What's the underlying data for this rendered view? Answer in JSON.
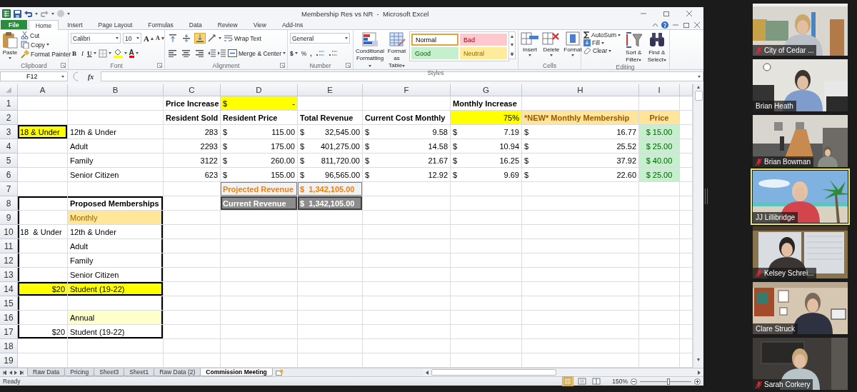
{
  "title_bar": {
    "title": "Membership Res vs NR  -  Microsoft Excel"
  },
  "ribbon_tabs": [
    {
      "label": "File",
      "kind": "file",
      "selected": false
    },
    {
      "label": "Home",
      "kind": "tab",
      "selected": true
    },
    {
      "label": "Insert",
      "kind": "tab",
      "selected": false
    },
    {
      "label": "Page Layout",
      "kind": "tab",
      "selected": false
    },
    {
      "label": "Formulas",
      "kind": "tab",
      "selected": false
    },
    {
      "label": "Data",
      "kind": "tab",
      "selected": false
    },
    {
      "label": "Review",
      "kind": "tab",
      "selected": false
    },
    {
      "label": "View",
      "kind": "tab",
      "selected": false
    },
    {
      "label": "Add-Ins",
      "kind": "tab",
      "selected": false
    }
  ],
  "ribbon_groups": [
    {
      "kind": "clipboard",
      "label": "Clipboard",
      "buttons": [
        "Paste",
        "Cut",
        "Copy",
        "Format Painter"
      ]
    },
    {
      "kind": "font",
      "label": "Font",
      "font_name": "Calibri",
      "font_size": "10",
      "buttons": [
        "A",
        "A",
        "B",
        "I",
        "U",
        "A"
      ]
    },
    {
      "kind": "alignment",
      "label": "Alignment",
      "vertical_align": [
        {
          "selected": false
        },
        {
          "selected": false
        },
        {
          "selected": true
        }
      ],
      "buttons": [
        "Wrap Text",
        "Merge & Center"
      ]
    },
    {
      "kind": "number",
      "label": "Number",
      "format": "General",
      "buttons": [
        "$",
        "%",
        ","
      ]
    },
    {
      "kind": "styles",
      "label": "Styles",
      "buttons": [
        "Conditional Formatting",
        "Format as Table"
      ],
      "cell_styles": [
        {
          "label": "Normal",
          "kind": "normal",
          "selected": true
        },
        {
          "label": "Bad",
          "kind": "bad",
          "selected": false
        },
        {
          "label": "Good",
          "kind": "good",
          "selected": false
        },
        {
          "label": "Neutral",
          "kind": "neutral",
          "selected": false
        }
      ]
    },
    {
      "kind": "cells",
      "label": "Cells",
      "buttons": [
        "Insert",
        "Delete",
        "Format"
      ]
    },
    {
      "kind": "editing",
      "label": "Editing",
      "buttons": [
        "AutoSum",
        "Fill",
        "Clear",
        "Sort & Filter",
        "Find & Select"
      ]
    }
  ],
  "formula_bar": {
    "name_box": "F12",
    "function_label": "fx"
  },
  "sheet": {
    "columns": [
      "A",
      "B",
      "C",
      "D",
      "E",
      "F",
      "G",
      "H",
      "I"
    ],
    "rows": [
      {
        "number": "1",
        "cells": [
          null,
          null,
          {
            "kind": "bold",
            "text": "Price Increase"
          },
          {
            "kind": "currency-highlight",
            "symbol": "$",
            "text": "-"
          },
          null,
          null,
          {
            "kind": "bold",
            "text": "Monthly Increase"
          }
        ]
      },
      {
        "number": "2",
        "cells": [
          null,
          null,
          {
            "kind": "bold",
            "text": "Resident Sold"
          },
          {
            "kind": "bold",
            "text": "Resident Price"
          },
          {
            "kind": "bold",
            "text": "Total Revenue"
          },
          {
            "kind": "bold",
            "text": "Current Cost Monthly"
          },
          {
            "kind": "number-highlight",
            "text": "75%"
          },
          {
            "kind": "heading-accent",
            "text": "*NEW* Monthly Membership"
          },
          {
            "kind": "price-accent",
            "text": "Price"
          }
        ]
      },
      {
        "number": "3",
        "cells": [
          {
            "kind": "highlight-boxed",
            "text": "18 & Under"
          },
          {
            "kind": "text",
            "text": "12th & Under"
          },
          {
            "kind": "number",
            "text": "283"
          },
          {
            "kind": "currency",
            "symbol": "$",
            "text": "115.00"
          },
          {
            "kind": "currency",
            "symbol": "$",
            "text": "32,545.00"
          },
          {
            "kind": "currency",
            "symbol": "$",
            "text": "9.58"
          },
          {
            "kind": "currency",
            "symbol": "$",
            "text": "7.19"
          },
          {
            "kind": "currency",
            "symbol": "$",
            "text": "16.77"
          },
          {
            "kind": "price-good",
            "text": "$ 15.00"
          }
        ]
      },
      {
        "number": "4",
        "cells": [
          null,
          {
            "kind": "text",
            "text": "Adult"
          },
          {
            "kind": "number",
            "text": "2293"
          },
          {
            "kind": "currency",
            "symbol": "$",
            "text": "175.00"
          },
          {
            "kind": "currency",
            "symbol": "$",
            "text": "401,275.00"
          },
          {
            "kind": "currency",
            "symbol": "$",
            "text": "14.58"
          },
          {
            "kind": "currency",
            "symbol": "$",
            "text": "10.94"
          },
          {
            "kind": "currency",
            "symbol": "$",
            "text": "25.52"
          },
          {
            "kind": "price-good",
            "text": "$ 25.00"
          }
        ]
      },
      {
        "number": "5",
        "cells": [
          null,
          {
            "kind": "text",
            "text": "Family"
          },
          {
            "kind": "number",
            "text": "3122"
          },
          {
            "kind": "currency",
            "symbol": "$",
            "text": "260.00"
          },
          {
            "kind": "currency",
            "symbol": "$",
            "text": "811,720.00"
          },
          {
            "kind": "currency",
            "symbol": "$",
            "text": "21.67"
          },
          {
            "kind": "currency",
            "symbol": "$",
            "text": "16.25"
          },
          {
            "kind": "currency",
            "symbol": "$",
            "text": "37.92"
          },
          {
            "kind": "price-good",
            "text": "$ 40.00"
          }
        ]
      },
      {
        "number": "6",
        "cells": [
          null,
          {
            "kind": "text",
            "text": "Senior Citizen"
          },
          {
            "kind": "number",
            "text": "623"
          },
          {
            "kind": "currency",
            "symbol": "$",
            "text": "155.00"
          },
          {
            "kind": "currency",
            "symbol": "$",
            "text": "96,565.00"
          },
          {
            "kind": "currency",
            "symbol": "$",
            "text": "12.92"
          },
          {
            "kind": "currency",
            "symbol": "$",
            "text": "9.69"
          },
          {
            "kind": "currency",
            "symbol": "$",
            "text": "22.60"
          },
          {
            "kind": "price-good",
            "text": "$ 25.00"
          }
        ]
      },
      {
        "number": "7",
        "cells": [
          null,
          null,
          null,
          {
            "kind": "calculation",
            "text": "Projected Revenue"
          },
          {
            "kind": "calculation",
            "text": "$  1,342,105.00"
          }
        ]
      },
      {
        "number": "8",
        "kind": "frame-top",
        "cells": [
          null,
          {
            "kind": "bold",
            "text": "Proposed Memberships"
          },
          null,
          {
            "kind": "output",
            "text": "Current Revenue"
          },
          {
            "kind": "output",
            "text": "$  1,342,105.00"
          }
        ]
      },
      {
        "number": "9",
        "kind": "frame-middle",
        "cells": [
          null,
          {
            "kind": "note",
            "text": "Monthly"
          }
        ]
      },
      {
        "number": "10",
        "kind": "frame-middle",
        "cells": [
          {
            "kind": "text",
            "text": "18  & Under"
          },
          {
            "kind": "text",
            "text": "12th & Under"
          }
        ]
      },
      {
        "number": "11",
        "kind": "frame-middle",
        "cells": [
          null,
          {
            "kind": "text",
            "text": "Adult"
          }
        ]
      },
      {
        "number": "12",
        "kind": "frame-middle",
        "cells": [
          null,
          {
            "kind": "text",
            "text": "Family"
          }
        ]
      },
      {
        "number": "13",
        "kind": "frame-middle",
        "cells": [
          null,
          {
            "kind": "text",
            "text": "Senior Citizen"
          }
        ]
      },
      {
        "number": "14",
        "kind": "frame-single",
        "cells": [
          {
            "kind": "number-highlight",
            "text": "$20"
          },
          {
            "kind": "text-highlight",
            "text": "Student (19-22)"
          }
        ]
      },
      {
        "number": "15",
        "kind": "frame-middle"
      },
      {
        "number": "16",
        "kind": "frame-middle",
        "cells": [
          null,
          {
            "kind": "annual",
            "text": "Annual"
          }
        ]
      },
      {
        "number": "17",
        "kind": "frame-bottom",
        "cells": [
          {
            "kind": "number",
            "text": "$20"
          },
          {
            "kind": "text",
            "text": "Student (19-22)"
          }
        ]
      },
      {
        "number": "18"
      },
      {
        "number": "19"
      }
    ]
  },
  "sheet_tabs": [
    {
      "label": "Raw Data",
      "selected": false
    },
    {
      "label": "Pricing",
      "selected": false
    },
    {
      "label": "Sheet3",
      "selected": false
    },
    {
      "label": "Sheet1",
      "selected": false
    },
    {
      "label": "Raw Data (2)",
      "selected": false
    },
    {
      "label": "Commission Meeting",
      "selected": true
    }
  ],
  "status_bar": {
    "status": "Ready",
    "zoom": "150%",
    "zoom_slider": {
      "level": 0.55
    }
  },
  "participants": [
    {
      "name": "City of Cedar ...",
      "muted": true,
      "speaking": false
    },
    {
      "name": "Brian Heath",
      "muted": false,
      "speaking": false
    },
    {
      "name": "Brian Bowman",
      "muted": true,
      "speaking": false
    },
    {
      "name": "JJ Lillibridge",
      "muted": false,
      "speaking": true
    },
    {
      "name": "Kelsey Schrei...",
      "muted": true,
      "speaking": false
    },
    {
      "name": "Clare Struck",
      "muted": false,
      "speaking": false
    },
    {
      "name": "Sarah Corkery",
      "muted": true,
      "speaking": false
    }
  ]
}
